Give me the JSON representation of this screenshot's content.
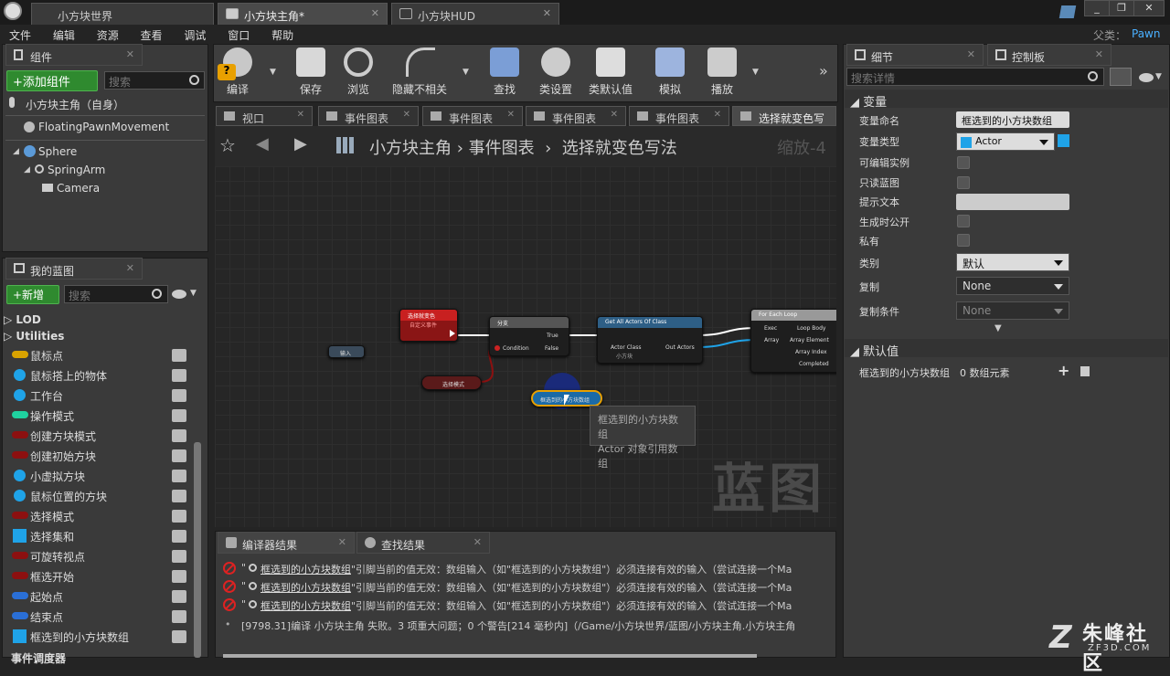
{
  "window": {
    "tabs": [
      {
        "label": "小方块世界"
      },
      {
        "label": "小方块主角*"
      },
      {
        "label": "小方块HUD"
      }
    ],
    "parent_label": "父类：",
    "parent_value": "Pawn"
  },
  "menu": [
    "文件",
    "编辑",
    "资源",
    "查看",
    "调试",
    "窗口",
    "帮助"
  ],
  "components": {
    "tab_label": "组件",
    "add_button": "+添加组件",
    "search_placeholder": "搜索",
    "self_label": "小方块主角（自身）",
    "items": [
      "FloatingPawnMovement",
      "Sphere",
      "SpringArm",
      "Camera"
    ]
  },
  "my_blueprint": {
    "tab_label": "我的蓝图",
    "new_button": "+新增",
    "search_placeholder": "搜索",
    "groups": [
      "LOD",
      "Utilities"
    ],
    "variables": [
      {
        "label": "鼠标点",
        "type": "pill",
        "color": "#d9a300"
      },
      {
        "label": "鼠标搭上的物体",
        "type": "dot",
        "color": "#1fa3e8"
      },
      {
        "label": "工作台",
        "type": "dot",
        "color": "#1fa3e8"
      },
      {
        "label": "操作模式",
        "type": "pill",
        "color": "#1fd19f"
      },
      {
        "label": "创建方块模式",
        "type": "pill",
        "color": "#8c1010"
      },
      {
        "label": "创建初始方块",
        "type": "pill",
        "color": "#8c1010"
      },
      {
        "label": "小虚拟方块",
        "type": "dot",
        "color": "#1fa3e8"
      },
      {
        "label": "鼠标位置的方块",
        "type": "dot",
        "color": "#1fa3e8"
      },
      {
        "label": "选择模式",
        "type": "pill",
        "color": "#8c1010"
      },
      {
        "label": "选择集和",
        "type": "grid",
        "color": "#1fa3e8"
      },
      {
        "label": "可旋转视点",
        "type": "pill",
        "color": "#8c1010"
      },
      {
        "label": "框选开始",
        "type": "pill",
        "color": "#8c1010"
      },
      {
        "label": "起始点",
        "type": "pill",
        "color": "#2a6fd6"
      },
      {
        "label": "结束点",
        "type": "pill",
        "color": "#2a6fd6"
      },
      {
        "label": "框选到的小方块数组",
        "type": "grid",
        "color": "#1fa3e8"
      }
    ],
    "footer_label": "事件调度器"
  },
  "toolbar": [
    {
      "label": "编译"
    },
    {
      "label": "保存"
    },
    {
      "label": "浏览"
    },
    {
      "label": "隐藏不相关"
    },
    {
      "label": "查找"
    },
    {
      "label": "类设置"
    },
    {
      "label": "类默认值"
    },
    {
      "label": "模拟"
    },
    {
      "label": "播放"
    }
  ],
  "graph_tabs": [
    "视口",
    "事件图表",
    "事件图表",
    "事件图表",
    "事件图表",
    "选择就变色写"
  ],
  "breadcrumb": {
    "parts": [
      "小方块主角",
      "事件图表",
      "选择就变色写法"
    ],
    "zoom": "缩放-4"
  },
  "graph": {
    "watermark": "蓝图",
    "nodes": {
      "event": {
        "title": "选择就变色",
        "subtitle": "自定义事件"
      },
      "input": {
        "label": "输入"
      },
      "branch": {
        "title": "分支",
        "true": "True",
        "false": "False",
        "condition": "Condition"
      },
      "get_actors": {
        "title": "Get All Actors Of Class",
        "actor_class": "Actor Class",
        "class_value": "小方块",
        "out": "Out Actors"
      },
      "foreach": {
        "title": "For Each Loop",
        "exec": "Exec",
        "array": "Array",
        "loop_body": "Loop Body",
        "element": "Array Element",
        "index": "Array Index",
        "completed": "Completed"
      },
      "select_mode": {
        "label": "选择模式"
      },
      "array_var": {
        "label": "框选到的小方块数组"
      }
    },
    "tooltip": {
      "line1": "框选到的小方块数组",
      "line2": "Actor 对象引用数组"
    }
  },
  "details": {
    "tab_label": "细节",
    "control_tab_label": "控制板",
    "search_placeholder": "搜索详情",
    "section_variable": "变量",
    "rows": [
      {
        "label": "变量命名",
        "value": "框选到的小方块数组"
      },
      {
        "label": "变量类型",
        "value": "Actor"
      },
      {
        "label": "可编辑实例"
      },
      {
        "label": "只读蓝图"
      },
      {
        "label": "提示文本",
        "value": ""
      },
      {
        "label": "生成时公开"
      },
      {
        "label": "私有"
      },
      {
        "label": "类别",
        "value": "默认"
      },
      {
        "label": "复制",
        "value": "None"
      },
      {
        "label": "复制条件",
        "value": "None"
      }
    ],
    "section_default": "默认值",
    "default_row": {
      "label": "框选到的小方块数组",
      "value": "0 数组元素"
    }
  },
  "results": {
    "tabs": [
      "编译器结果",
      "查找结果"
    ],
    "errors": [
      {
        "var": "框选到的小方块数组",
        "msg": "\"引脚当前的值无效：数组输入（如\"框选到的小方块数组\"）必须连接有效的输入（尝试连接一个Ma"
      },
      {
        "var": "框选到的小方块数组",
        "msg": "\"引脚当前的值无效：数组输入（如\"框选到的小方块数组\"）必须连接有效的输入（尝试连接一个Ma"
      },
      {
        "var": "框选到的小方块数组",
        "msg": "\"引脚当前的值无效：数组输入（如\"框选到的小方块数组\"）必须连接有效的输入（尝试连接一个Ma"
      }
    ],
    "summary": "[9798.31]编译 小方块主角 失败。3 项重大问题；0 个警告[214 毫秒内]（/Game/小方块世界/蓝图/小方块主角.小方块主角"
  },
  "watermark_site": {
    "name": "朱峰社区",
    "url": "ZF3D.COM"
  }
}
